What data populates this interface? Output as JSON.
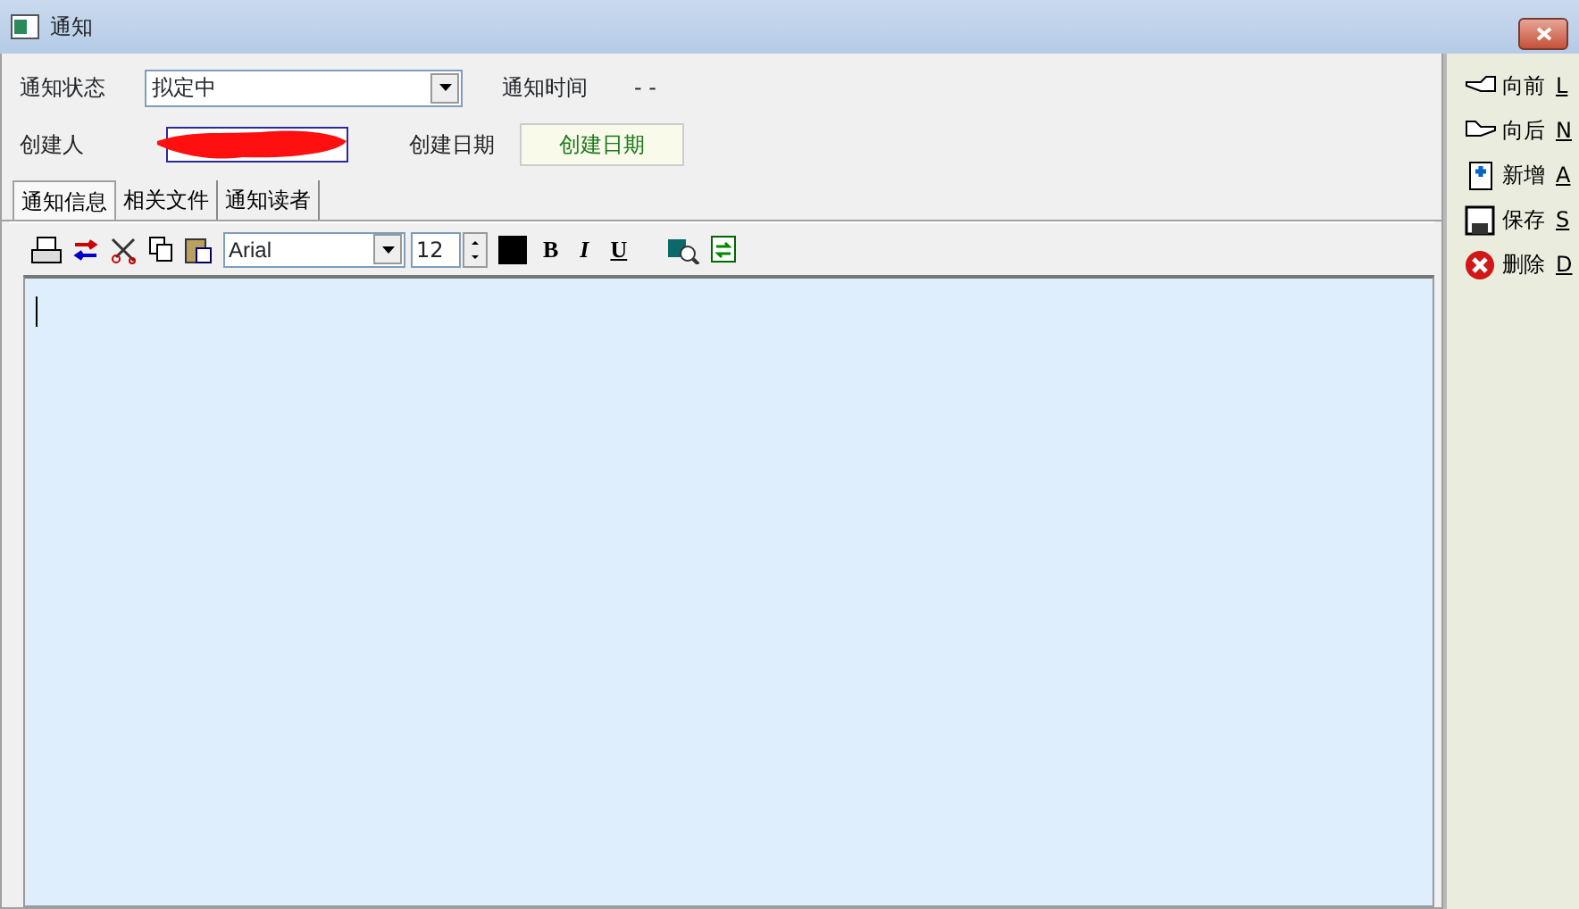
{
  "window": {
    "title": "通知"
  },
  "form": {
    "status_label": "通知状态",
    "status_value": "拟定中",
    "time_label": "通知时间",
    "time_value": "- -",
    "creator_label": "创建人",
    "date_label": "创建日期",
    "date_button": "创建日期"
  },
  "tabs": [
    {
      "label": "通知信息",
      "selected": true
    },
    {
      "label": "相关文件",
      "selected": false
    },
    {
      "label": "通知读者",
      "selected": false
    }
  ],
  "toolbar": {
    "font": "Arial",
    "size": "12",
    "format_buttons": [
      {
        "kind": "bold",
        "label": "B"
      },
      {
        "kind": "italic",
        "label": "I"
      },
      {
        "kind": "underline",
        "label": "U"
      }
    ]
  },
  "actions": [
    {
      "kind": "back",
      "label": "向前",
      "key": "L"
    },
    {
      "kind": "next",
      "label": "向后",
      "key": "N"
    },
    {
      "kind": "new",
      "label": "新增",
      "key": "A"
    },
    {
      "kind": "save",
      "label": "保存",
      "key": "S"
    },
    {
      "kind": "delete",
      "label": "删除",
      "key": "D"
    }
  ]
}
